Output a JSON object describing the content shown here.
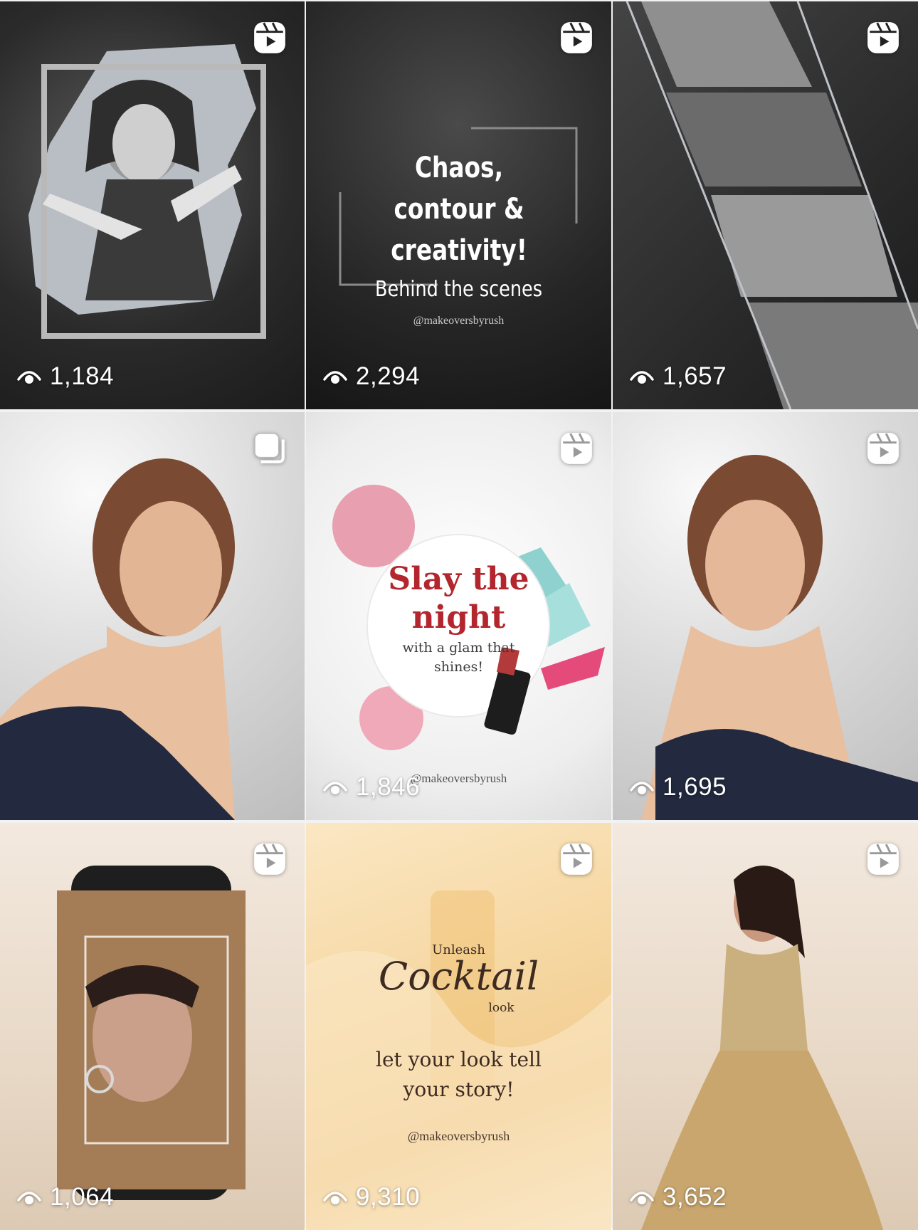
{
  "posts": [
    {
      "id": "p1",
      "type": "reel",
      "views": "1,184"
    },
    {
      "id": "p2",
      "type": "reel",
      "views": "2,294",
      "overlay": {
        "headline": "Chaos, contour & creativity!",
        "sub": "Behind the scenes",
        "handle": "@makeoversbyrush"
      }
    },
    {
      "id": "p3",
      "type": "reel",
      "views": "1,657"
    },
    {
      "id": "p4",
      "type": "carousel",
      "views": ""
    },
    {
      "id": "p5",
      "type": "reel",
      "views": "1,846",
      "overlay": {
        "headline": "Slay the night",
        "sub": "with a glam that shines!",
        "handle": "@makeoversbyrush"
      }
    },
    {
      "id": "p6",
      "type": "reel",
      "views": "1,695"
    },
    {
      "id": "p7",
      "type": "reel",
      "views": "1,064"
    },
    {
      "id": "p8",
      "type": "reel",
      "views": "9,310",
      "overlay": {
        "kicker": "Unleash",
        "headline": "Cocktail",
        "tag": "look",
        "sub": "let your look tell your story!",
        "handle": "@makeoversbyrush"
      }
    },
    {
      "id": "p9",
      "type": "reel",
      "views": "3,652"
    }
  ],
  "icons": {
    "reel": "reels-icon",
    "carousel": "carousel-icon",
    "views": "eye-views-icon"
  },
  "colors": {
    "text_on_tile": "#ffffff",
    "slay_red": "#b3262e",
    "cocktail_brown": "#3d2b22"
  }
}
